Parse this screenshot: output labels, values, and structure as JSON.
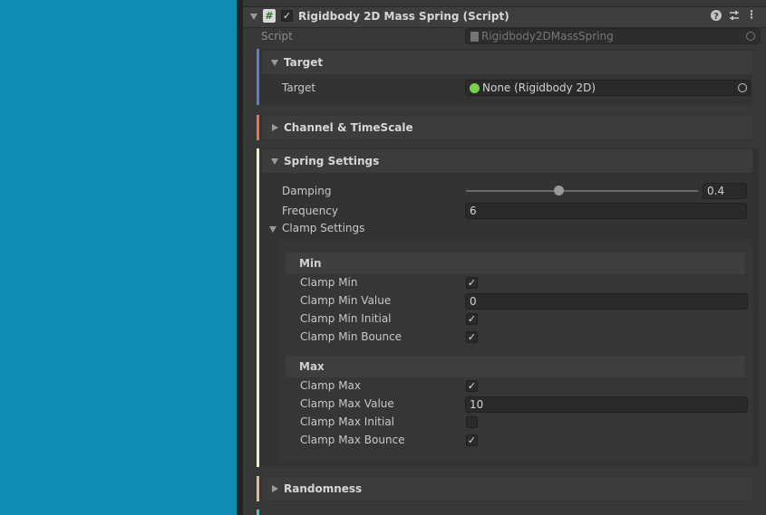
{
  "component": {
    "title": "Rigidbody 2D Mass Spring (Script)",
    "enabled": true,
    "script_label": "Script",
    "script_value": "Rigidbody2DMassSpring"
  },
  "target_section": {
    "header": "Target",
    "stripe_color": "#5b7fd6",
    "target_label": "Target",
    "target_value": "None (Rigidbody 2D)"
  },
  "channel_section": {
    "header": "Channel & TimeScale",
    "stripe_color": "#e8764a"
  },
  "spring_section": {
    "header": "Spring Settings",
    "stripe_color": "#f4edc5",
    "damping_label": "Damping",
    "damping_value": "0.4",
    "damping_fraction": 0.4,
    "frequency_label": "Frequency",
    "frequency_value": "6",
    "clamp_label": "Clamp Settings",
    "min": {
      "header": "Min",
      "rows": [
        {
          "label": "Clamp Min",
          "type": "checkbox",
          "checked": true
        },
        {
          "label": "Clamp Min Value",
          "type": "text",
          "value": "0"
        },
        {
          "label": "Clamp Min Initial",
          "type": "checkbox",
          "checked": true
        },
        {
          "label": "Clamp Min Bounce",
          "type": "checkbox",
          "checked": true
        }
      ]
    },
    "max": {
      "header": "Max",
      "rows": [
        {
          "label": "Clamp Max",
          "type": "checkbox",
          "checked": true
        },
        {
          "label": "Clamp Max Value",
          "type": "text",
          "value": "10"
        },
        {
          "label": "Clamp Max Initial",
          "type": "checkbox",
          "checked": false
        },
        {
          "label": "Clamp Max Bounce",
          "type": "checkbox",
          "checked": true
        }
      ]
    }
  },
  "randomness_section": {
    "header": "Randomness",
    "stripe_color": "#e8b98a"
  },
  "next_stripe_color": "#3ec6e0",
  "icons": [
    "script-hash-icon",
    "help-icon",
    "preset-icon",
    "more-icon",
    "object-picker-icon",
    "rigidbody-icon"
  ]
}
